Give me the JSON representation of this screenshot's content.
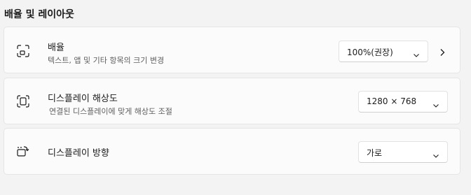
{
  "section": {
    "title": "배율 및 레이아웃"
  },
  "rows": [
    {
      "title": "배율",
      "subtitle": "텍스트, 앱 및 기타 항목의 크기 변경",
      "icon": "scale-icon",
      "control": {
        "value": "100%(권장)"
      }
    },
    {
      "title": "디스플레이 해상도",
      "subtitle": "연결된 디스플레이에 맞게 해상도 조절",
      "icon": "resolution-icon",
      "control": {
        "value": "1280 × 768"
      }
    },
    {
      "title": "디스플레이 방향",
      "icon": "orientation-icon",
      "control": {
        "value": "가로"
      }
    }
  ],
  "icons": {
    "dropdown": "chevron-down-icon",
    "nav": "chevron-right-icon"
  },
  "colors": {
    "background": "#f3f3f3",
    "card": "#fbfbfb",
    "text": "#1b1b1b",
    "subtext": "#5f5f5f"
  }
}
